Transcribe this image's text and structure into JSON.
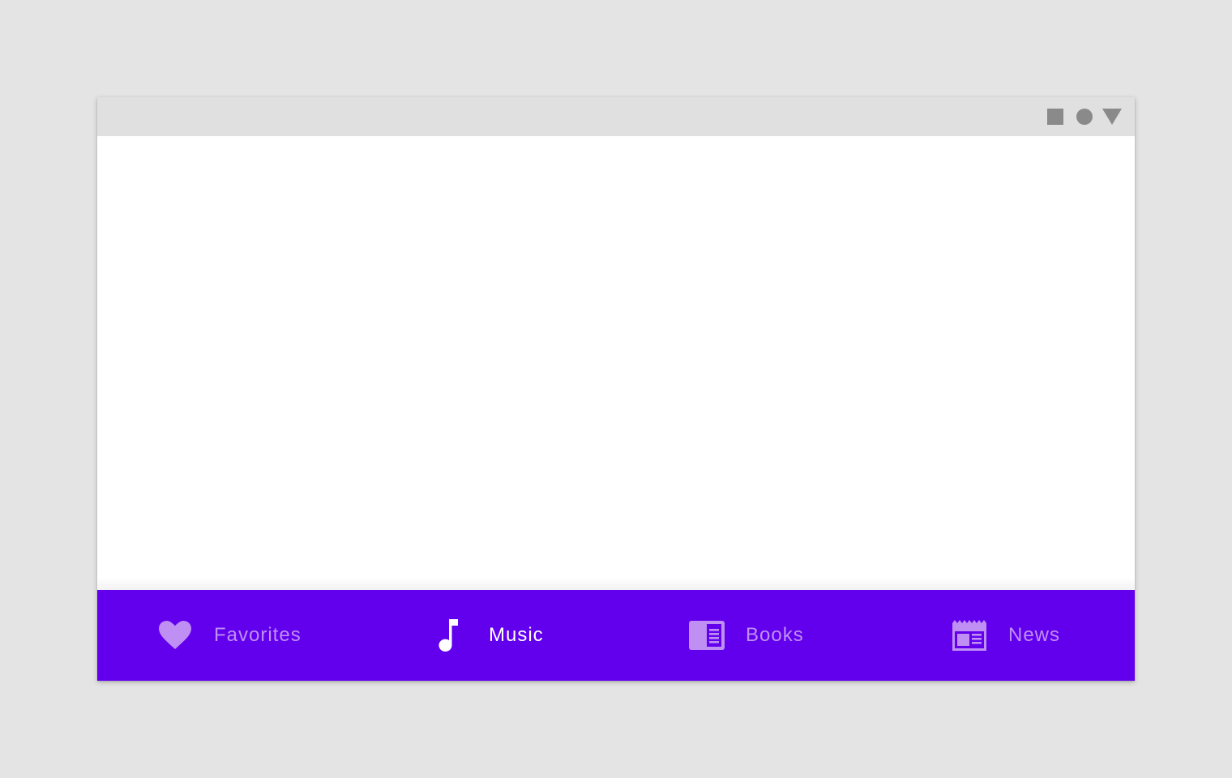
{
  "window": {
    "controls": [
      {
        "icon": "square-icon"
      },
      {
        "icon": "circle-icon"
      },
      {
        "icon": "triangle-icon"
      }
    ]
  },
  "bottom_nav": {
    "active_index": 1,
    "items": [
      {
        "label": "Favorites",
        "icon": "heart-icon"
      },
      {
        "label": "Music",
        "icon": "music-note-icon"
      },
      {
        "label": "Books",
        "icon": "book-icon"
      },
      {
        "label": "News",
        "icon": "newspaper-icon"
      }
    ]
  },
  "colors": {
    "nav_background": "#6200ee",
    "nav_inactive": "#bf8ff4",
    "nav_active": "#ffffff",
    "titlebar": "#e0e0e0",
    "control_icons": "#8a8a8a",
    "page_background": "#e4e4e4"
  }
}
